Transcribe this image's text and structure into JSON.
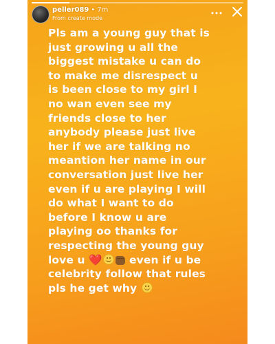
{
  "story": {
    "progress": 0.18,
    "user": {
      "username": "peller089",
      "separator": "•",
      "time": "7m",
      "mode": "From create mode"
    },
    "icons": {
      "more": "more-dots-icon",
      "close": "close-icon",
      "heart": "heart-emoji",
      "smile": "smiling-face-emoji",
      "fist": "fist-bump-emoji"
    },
    "colors": {
      "background_top": "#f8b31c",
      "background_bottom": "#f58a1c",
      "text": "#ffffff",
      "heart": "#e0181b"
    },
    "message_lines": [
      "Pls am a young guy that is",
      "just growing u all the",
      "biggest mistake u can do",
      "to make me disrespect u",
      "is been close to my girl I",
      "no wan even see my",
      "friends close to her",
      "anybody please just live",
      "her if we are talking no",
      "meantion her name in our",
      "conversation  just live her",
      "even if u are playing I will",
      "do what I want to do",
      "before I know u are",
      "playing oo thanks for",
      "respecting the young guy"
    ],
    "line_love": "love u",
    "emoji_heart": "❤️",
    "line_love_tail": "even if u be",
    "message_tail_lines": [
      "celebrity follow that rules",
      "pls he get why"
    ]
  }
}
